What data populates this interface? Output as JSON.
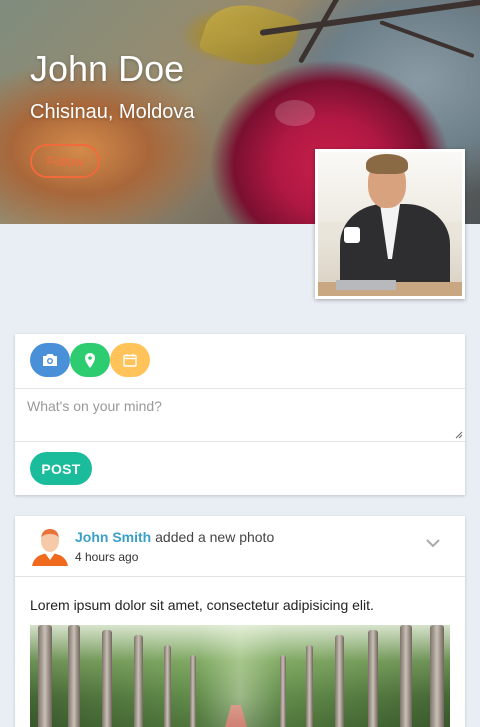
{
  "profile": {
    "name": "John Doe",
    "location": "Chisinau, Moldova",
    "follow_label": "Follow",
    "avatar_alt": "profile photo"
  },
  "composer": {
    "icons": [
      "camera-icon",
      "location-pin-icon",
      "calendar-icon"
    ],
    "icon_colors": {
      "camera": "#4a90d9",
      "location": "#2ecc71",
      "calendar": "#ffc35a"
    },
    "placeholder": "What's on your mind?",
    "value": "",
    "post_label": "POST"
  },
  "feed": {
    "author": "John Smith",
    "action": " added a new photo",
    "time": "4 hours ago",
    "text": "Lorem ipsum dolor sit amet, consectetur adipisicing elit."
  },
  "colors": {
    "accent_orange": "#f06a3b",
    "post_green": "#1abc9c",
    "link_blue": "#3aa0c8",
    "page_background": "#e9eef4"
  }
}
